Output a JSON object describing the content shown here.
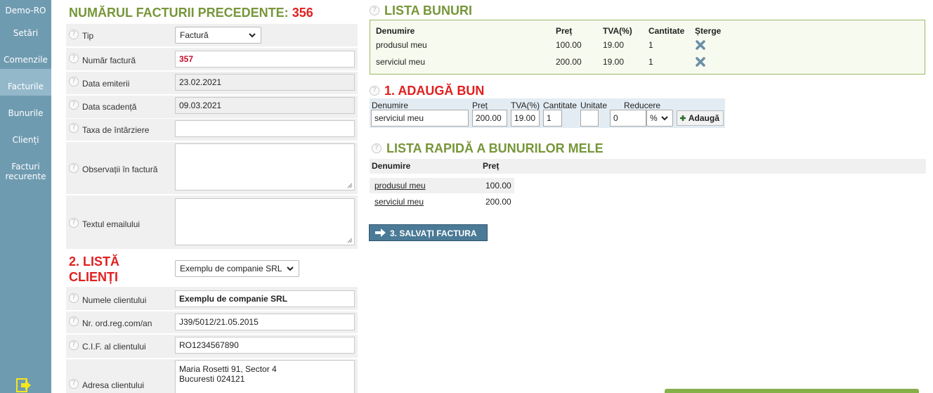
{
  "sidebar": {
    "items": [
      {
        "label": "Demo-RO"
      },
      {
        "label": "Setări"
      },
      {
        "label": "Comenzile"
      },
      {
        "label": "Facturile"
      },
      {
        "label": "Bunurile"
      },
      {
        "label": "Clienți"
      },
      {
        "label": "Facturi recurente"
      }
    ],
    "active_index": 3,
    "exit_icon": "exit-arrow-icon"
  },
  "form": {
    "title_prefix": "NUMĂRUL FACTURII PRECEDENTE:",
    "title_number": "356",
    "help_glyph": "?",
    "fields": {
      "tip": {
        "label": "Tip",
        "value": "Factură"
      },
      "numar": {
        "label": "Număr factură",
        "value": "357"
      },
      "data_emiterii": {
        "label": "Data emiterii",
        "value": "23.02.2021"
      },
      "data_scadenta": {
        "label": "Data scadență",
        "value": "09.03.2021"
      },
      "taxa": {
        "label": "Taxa de întârziere",
        "value": ""
      },
      "observatii": {
        "label": "Observații în factură",
        "value": ""
      },
      "email": {
        "label": "Textul emailului",
        "value": ""
      }
    },
    "clients_title_line1": "2. LISTĂ",
    "clients_title_line2": "CLIENȚI",
    "client_select": "Exemplu de companie SRL",
    "client_fields": {
      "nume": {
        "label": "Numele clientului",
        "value": "Exemplu de companie SRL"
      },
      "reg": {
        "label": "Nr. ord.reg.com/an",
        "value": "J39/5012/21.05.2015"
      },
      "cif": {
        "label": "C.I.F. al clientului",
        "value": "RO1234567890"
      },
      "adresa": {
        "label": "Adresa clientului",
        "line1": "Maria Rosetti 91, Sector 4",
        "line2": "Bucuresti 024121"
      }
    }
  },
  "goods_list": {
    "title": "LISTA BUNURI",
    "columns": [
      "Denumire",
      "Preț",
      "TVA(%)",
      "Cantitate",
      "Șterge"
    ],
    "rows": [
      {
        "name": "produsul meu",
        "price": "100.00",
        "tva": "19.00",
        "qty": "1"
      },
      {
        "name": "serviciul meu",
        "price": "200.00",
        "tva": "19.00",
        "qty": "1"
      }
    ],
    "delete_icon": "x-delete-icon"
  },
  "add_good": {
    "title": "1. ADAUGĂ BUN",
    "labels": {
      "name": "Denumire",
      "price": "Preț",
      "tva": "TVA(%)",
      "qty": "Cantitate",
      "unit": "Unitate",
      "discount": "Reducere"
    },
    "values": {
      "name": "serviciul meu",
      "price": "200.00",
      "tva": "19.00",
      "qty": "1",
      "unit": "",
      "discount": "0",
      "discount_type": "%"
    },
    "button": "Adaugă"
  },
  "quick_list": {
    "title": "LISTA RAPIDĂ A BUNURILOR MELE",
    "columns": [
      "Denumire",
      "Preț"
    ],
    "rows": [
      {
        "name": "produsul meu",
        "price": "100.00"
      },
      {
        "name": "serviciul meu",
        "price": "200.00"
      }
    ]
  },
  "save_button": "3. SALVAȚI FACTURA",
  "colors": {
    "green": "#77963a",
    "red": "#e02020",
    "sidebar": "#6f9bb1",
    "save": "#4b7a96"
  }
}
